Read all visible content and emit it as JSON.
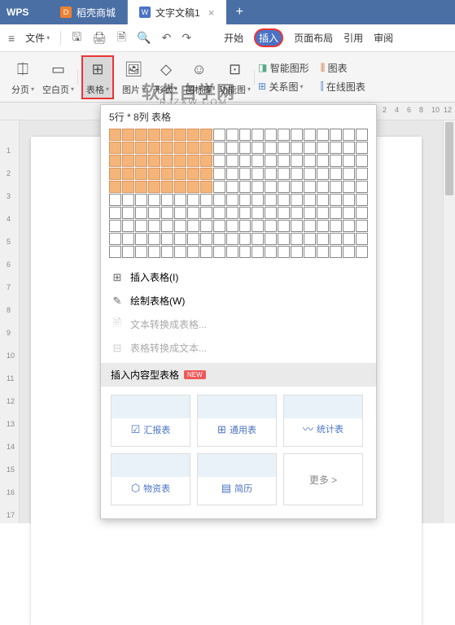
{
  "titlebar": {
    "app_name": "WPS",
    "tabs": [
      {
        "label": "稻壳商城",
        "icon_bg": "#f08030",
        "icon_text": "D"
      },
      {
        "label": "文字文稿1",
        "icon_bg": "#4a73c4",
        "icon_text": "W"
      }
    ]
  },
  "menubar": {
    "file": "文件",
    "items": [
      "开始",
      "插入",
      "页面布局",
      "引用",
      "审阅"
    ]
  },
  "toolbar": {
    "paging": "分页",
    "blank_page": "空白页",
    "table": "表格",
    "items_right": [
      "图片",
      "形状",
      "图标库",
      "功能图"
    ],
    "stacked": [
      {
        "icon": "◨",
        "label": "智能图形"
      },
      {
        "icon": "⊞",
        "label": "关系图"
      },
      {
        "icon": "⫼",
        "label": "图表"
      },
      {
        "icon": "⫿",
        "label": "在线图表"
      }
    ]
  },
  "dropdown": {
    "grid_label": "5行 * 8列 表格",
    "selected_rows": 5,
    "selected_cols": 8,
    "total_rows": 10,
    "total_cols": 20,
    "options": [
      {
        "icon": "⊞",
        "label": "插入表格(I)",
        "disabled": false
      },
      {
        "icon": "✎",
        "label": "绘制表格(W)",
        "disabled": false
      },
      {
        "icon": "🖹",
        "label": "文本转换成表格...",
        "disabled": true
      },
      {
        "icon": "⊟",
        "label": "表格转换成文本...",
        "disabled": true
      }
    ],
    "section_title": "插入内容型表格",
    "section_badge": "NEW",
    "templates": [
      {
        "icon": "☑",
        "label": "汇报表",
        "color": "#4a73c4"
      },
      {
        "icon": "⊞",
        "label": "通用表",
        "color": "#4a73c4"
      },
      {
        "icon": "〰",
        "label": "统计表",
        "color": "#4a73c4"
      },
      {
        "icon": "⬡",
        "label": "物资表",
        "color": "#4a73c4"
      },
      {
        "icon": "▤",
        "label": "简历",
        "color": "#4a73c4"
      }
    ],
    "more_label": "更多 >"
  },
  "ruler": {
    "h_nums": [
      2,
      4,
      6,
      8,
      10,
      12
    ],
    "v_nums": [
      1,
      2,
      3,
      4,
      5,
      6,
      7,
      8,
      9,
      10,
      11,
      12,
      13,
      14,
      15,
      16,
      17
    ]
  },
  "watermark": {
    "main": "软件自学网",
    "sub": "RJZXW.COM"
  }
}
